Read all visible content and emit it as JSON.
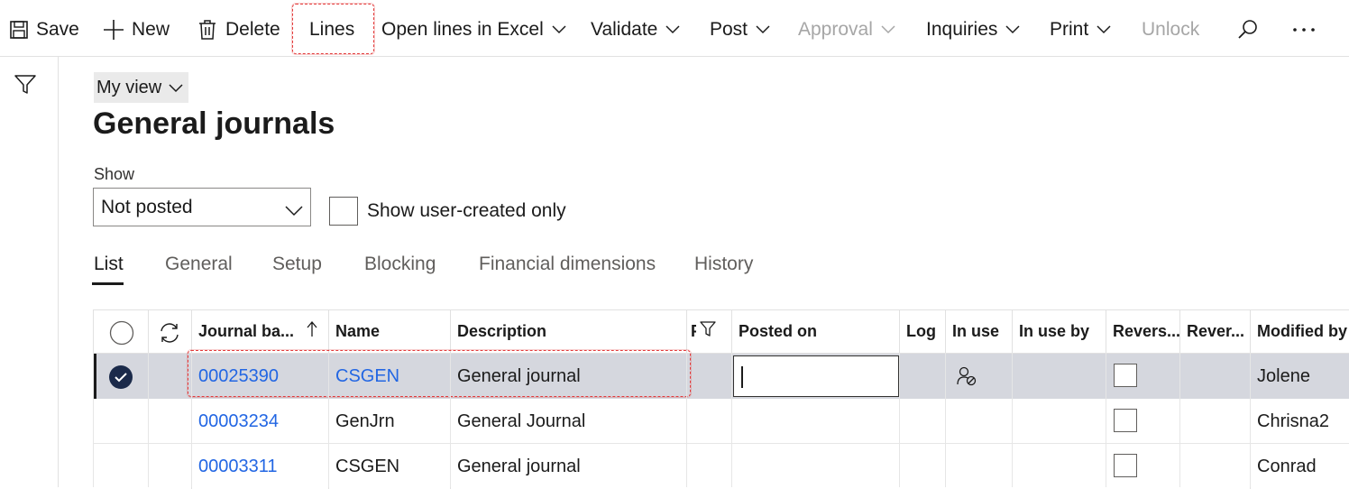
{
  "toolbar": {
    "save": "Save",
    "new": "New",
    "delete": "Delete",
    "lines": "Lines",
    "open_lines_excel": "Open lines in Excel",
    "validate": "Validate",
    "post": "Post",
    "approval": "Approval",
    "inquiries": "Inquiries",
    "print": "Print",
    "unlock": "Unlock"
  },
  "view": {
    "label": "My view"
  },
  "page": {
    "title": "General journals"
  },
  "filter": {
    "show_label": "Show",
    "show_value": "Not posted",
    "user_created_label": "Show user-created only"
  },
  "tabs": [
    "List",
    "General",
    "Setup",
    "Blocking",
    "Financial dimensions",
    "History"
  ],
  "grid": {
    "headers": {
      "journal_batch": "Journal ba...",
      "name": "Name",
      "description": "Description",
      "posted_flag": "P",
      "posted_on": "Posted on",
      "log": "Log",
      "in_use": "In use",
      "in_use_by": "In use by",
      "reverse1": "Revers...",
      "reverse2": "Rever...",
      "modified_by": "Modified by"
    },
    "rows": [
      {
        "journal_batch": "00025390",
        "name": "CSGEN",
        "description": "General journal",
        "modified_by": "Jolene"
      },
      {
        "journal_batch": "00003234",
        "name": "GenJrn",
        "description": "General Journal",
        "modified_by": "Chrisna2"
      },
      {
        "journal_batch": "00003311",
        "name": "CSGEN",
        "description": "General journal",
        "modified_by": "Conrad"
      }
    ]
  },
  "icons": {
    "save": "save-icon",
    "new": "plus-icon",
    "delete": "trash-icon",
    "search": "search-icon",
    "more": "more-icon",
    "filter": "filter-icon",
    "refresh": "refresh-icon",
    "sort": "sort-ascending-icon",
    "in_use": "user-lock-icon"
  },
  "colors": {
    "link": "#2266e3",
    "selected_row": "#d5d7de",
    "highlight": "#e23b3b"
  }
}
